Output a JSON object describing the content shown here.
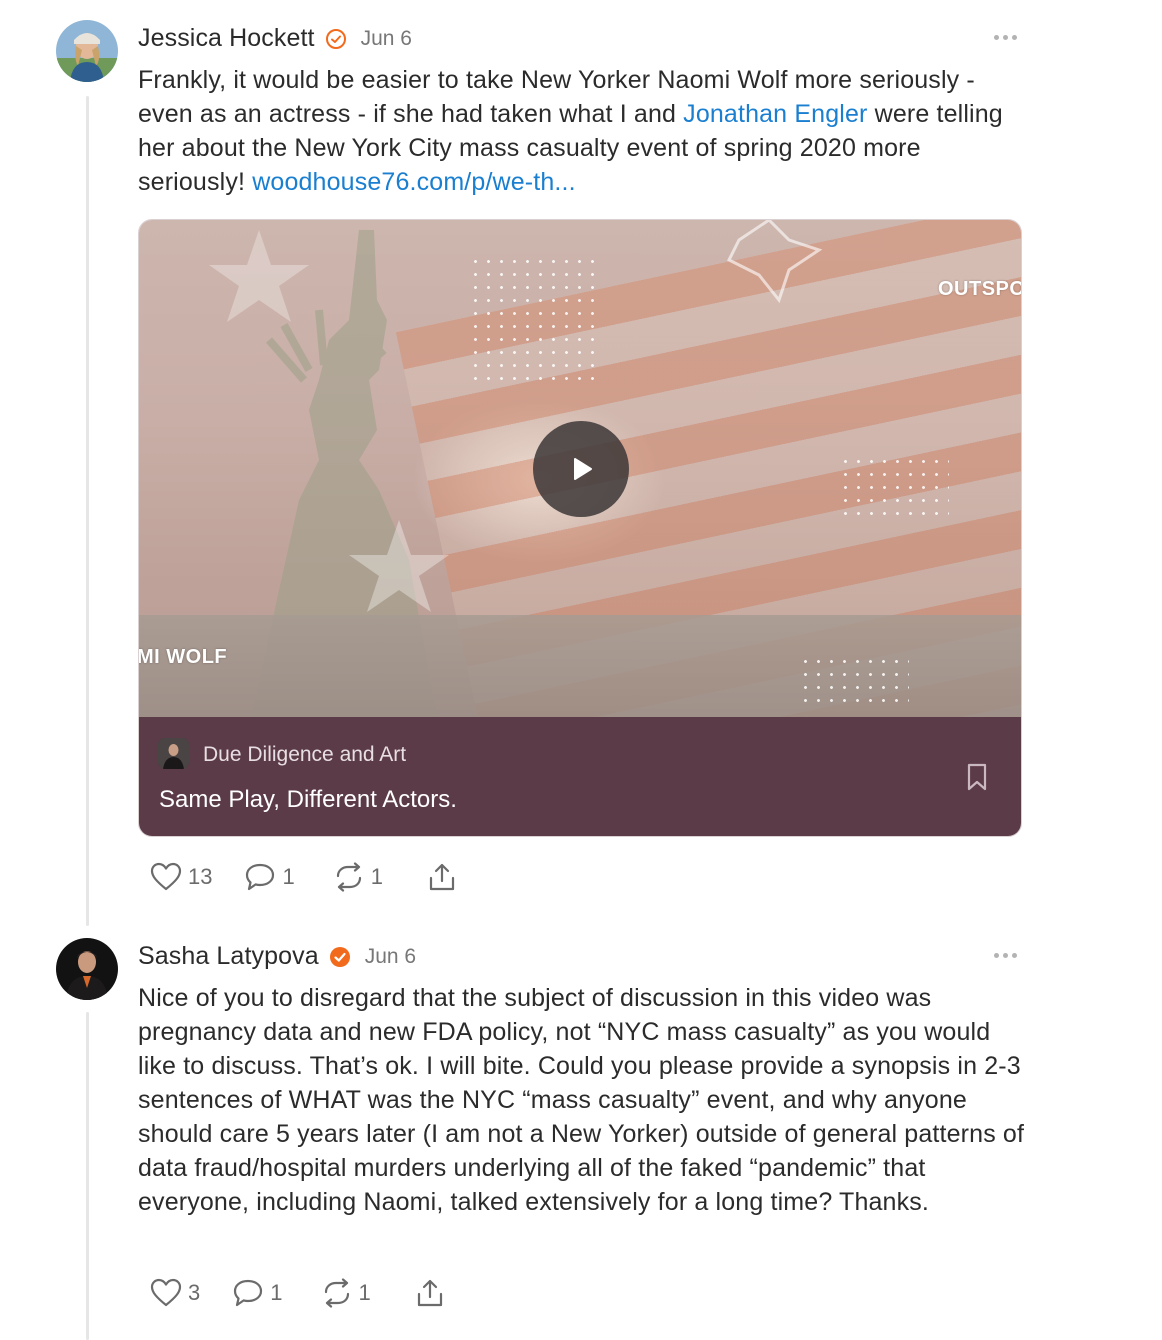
{
  "posts": [
    {
      "author": "Jessica Hockett",
      "date": "Jun 6",
      "text_before_link1": "Frankly, it would be easier to take New Yorker Naomi Wolf more seriously - even as an actress - if she had taken what I and ",
      "mention": "Jonathan Engler",
      "text_after_mention": " were telling her about the New York City mass casualty event of spring 2020 more seriously! ",
      "url": "woodhouse76.com/p/we-th...",
      "embed": {
        "overlay_left": "MI WOLF",
        "overlay_right": "OUTSPO",
        "publication": "Due Diligence and Art",
        "title": "Same Play, Different Actors."
      },
      "actions": {
        "likes": "13",
        "comments": "1",
        "restacks": "1"
      }
    },
    {
      "author": "Sasha Latypova",
      "date": "Jun 6",
      "text": "Nice of you to disregard that the subject of discussion in this video was pregnancy data and new FDA policy, not “NYC mass casualty” as you would like to discuss. That’s ok. I will bite. Could you please provide a synopsis in 2-3 sentences of WHAT was the NYC “mass casualty” event, and why anyone should care 5 years later (I am not a New Yorker) outside of general patterns of data fraud/hospital murders underlying all of the faked “pandemic” that everyone, including Naomi, talked extensively for a long time? Thanks.",
      "actions": {
        "likes": "3",
        "comments": "1",
        "restacks": "1"
      }
    }
  ],
  "colors": {
    "link": "#1a7fd0",
    "verified": "#f26a1b",
    "card_footer": "#5c3b48"
  }
}
